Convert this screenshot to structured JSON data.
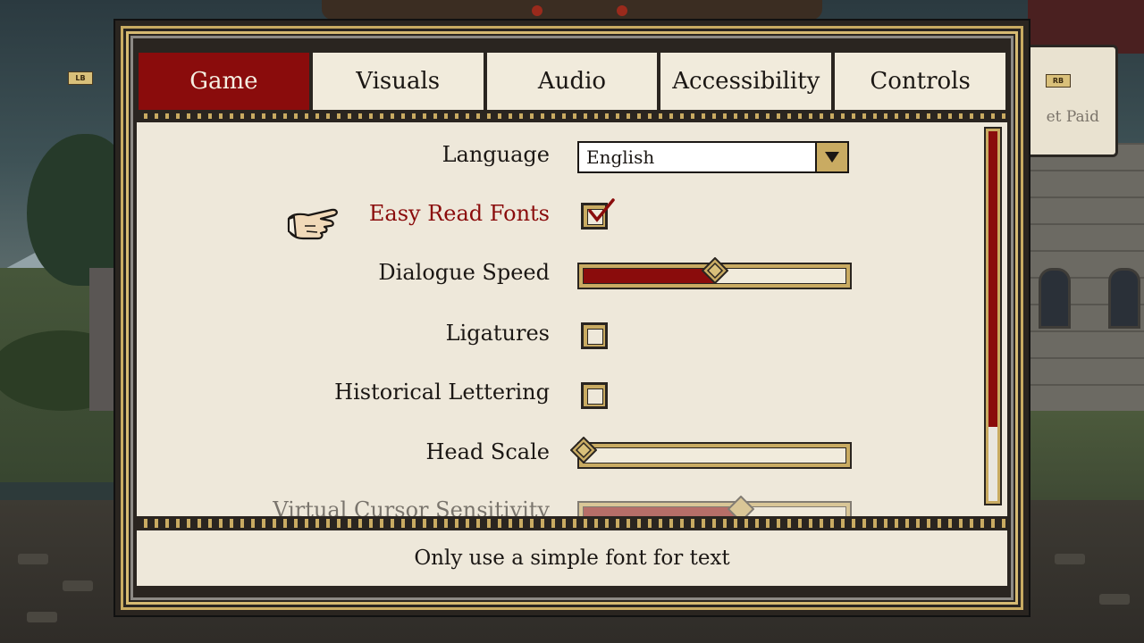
{
  "buttons": {
    "left_bumper": "LB",
    "right_bumper": "RB"
  },
  "background_card_text": "et Paid",
  "tabs": [
    {
      "label": "Game",
      "active": true
    },
    {
      "label": "Visuals",
      "active": false
    },
    {
      "label": "Audio",
      "active": false
    },
    {
      "label": "Accessibility",
      "active": false
    },
    {
      "label": "Controls",
      "active": false
    }
  ],
  "settings": {
    "language": {
      "label": "Language",
      "value": "English"
    },
    "easy_read_fonts": {
      "label": "Easy Read Fonts",
      "checked": true,
      "selected": true
    },
    "dialogue_speed": {
      "label": "Dialogue Speed",
      "value": 0.5
    },
    "ligatures": {
      "label": "Ligatures",
      "checked": false
    },
    "historical_lettering": {
      "label": "Historical Lettering",
      "checked": false
    },
    "head_scale": {
      "label": "Head Scale",
      "value": 0.0
    },
    "virtual_cursor_sensitivity": {
      "label": "Virtual Cursor Sensitivity",
      "value": 0.6
    }
  },
  "scroll": {
    "position": 0.8
  },
  "description": "Only use a simple font for text",
  "colors": {
    "accent": "#8a0c0c",
    "gold": "#c9ab62",
    "parchment": "#eee8da",
    "ink": "#1b1714"
  },
  "icons": {
    "pointer": "pointing-hand-icon",
    "dropdown": "chevron-down-icon",
    "check": "checkmark-icon"
  }
}
